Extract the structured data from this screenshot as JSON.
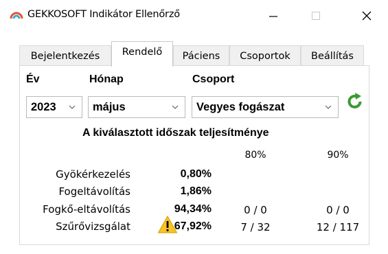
{
  "window": {
    "title": "GEKKOSOFT Indikátor Ellenőrző",
    "icon": "gauge-icon"
  },
  "tabs": [
    {
      "label": "Bejelentkezés",
      "active": false
    },
    {
      "label": "Rendelő",
      "active": true
    },
    {
      "label": "Páciens",
      "active": false
    },
    {
      "label": "Csoportok",
      "active": false
    },
    {
      "label": "Beállítás",
      "active": false
    }
  ],
  "filters": {
    "year_label": "Év",
    "month_label": "Hónap",
    "group_label": "Csoport",
    "year_value": "2023",
    "month_value": "május",
    "group_value": "Vegyes fogászat"
  },
  "performance": {
    "title": "A kiválasztott időszak teljesítménye",
    "columns": [
      "80%",
      "90%"
    ],
    "rows": [
      {
        "label": "Gyökérkezelés",
        "value": "0,80%",
        "c80": "",
        "c90": "",
        "warning": false
      },
      {
        "label": "Fogeltávolítás",
        "value": "1,86%",
        "c80": "",
        "c90": "",
        "warning": false
      },
      {
        "label": "Fogkő-eltávolítás",
        "value": "94,34%",
        "c80": "0 / 0",
        "c90": "0 / 0",
        "warning": false
      },
      {
        "label": "Szűrővizsgálat",
        "value": "67,92%",
        "c80": "7 / 32",
        "c90": "12 / 117",
        "warning": true
      }
    ]
  },
  "colors": {
    "refresh_green": "#3a9a32",
    "warning_yellow": "#f7c325",
    "tab_border": "#d9d9d9"
  }
}
